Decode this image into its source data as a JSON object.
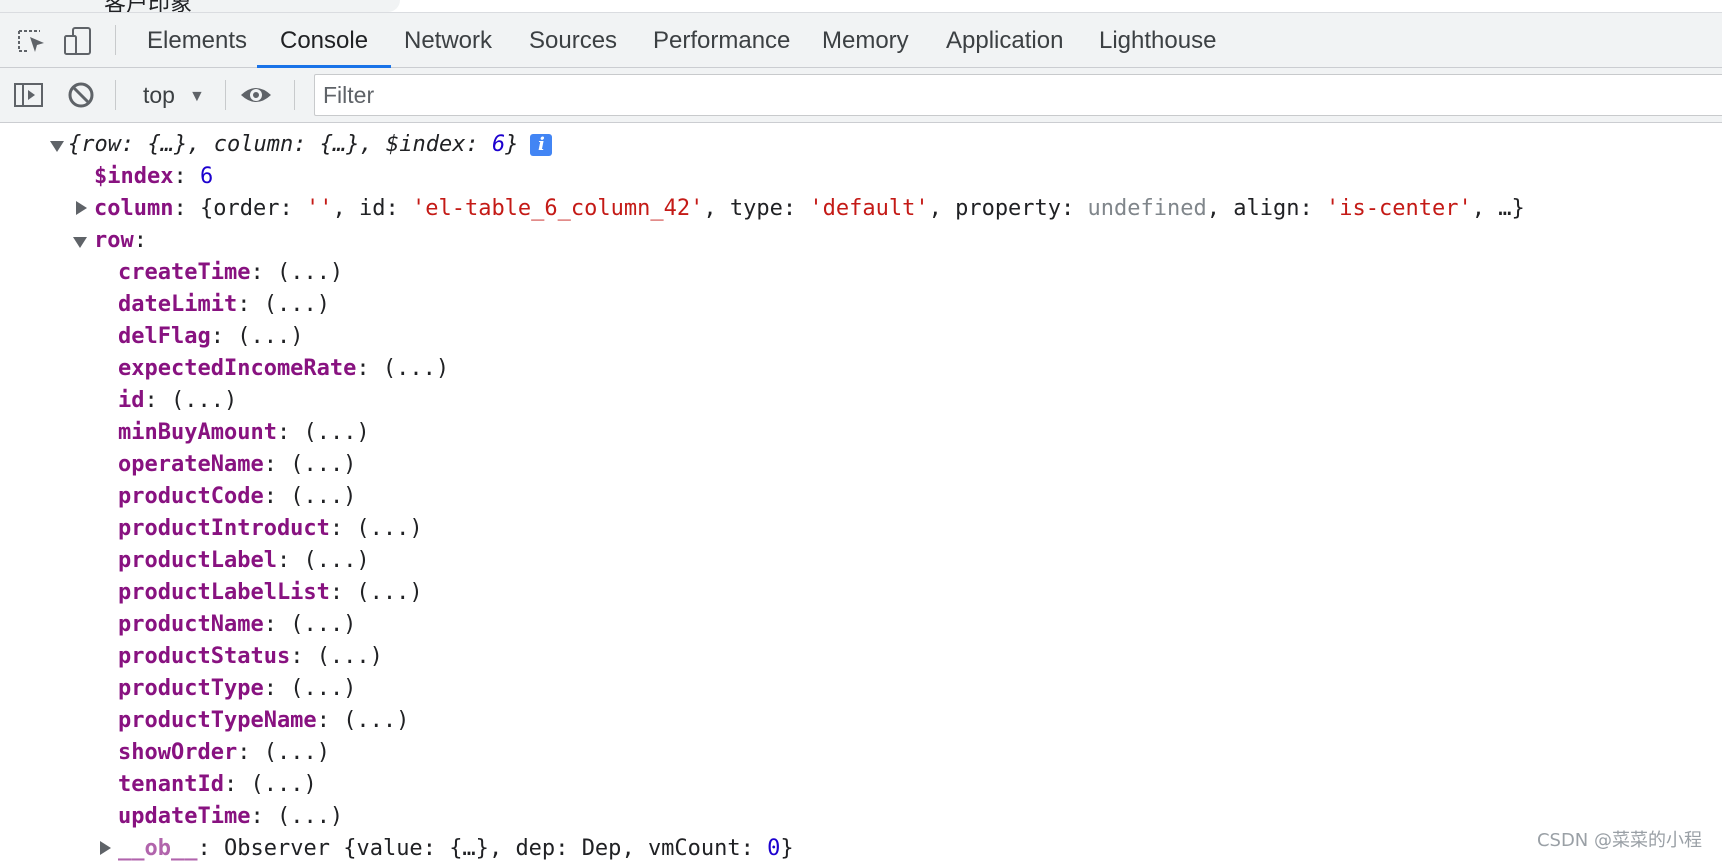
{
  "browser": {
    "partial_tab_title": "客户印象"
  },
  "devtools": {
    "tabs": [
      {
        "label": "Elements"
      },
      {
        "label": "Console"
      },
      {
        "label": "Network"
      },
      {
        "label": "Sources"
      },
      {
        "label": "Performance"
      },
      {
        "label": "Memory"
      },
      {
        "label": "Application"
      },
      {
        "label": "Lighthouse"
      }
    ],
    "active_tab": "Console",
    "toolbar": {
      "context": "top",
      "filter_placeholder": "Filter"
    }
  },
  "console": {
    "summary": {
      "open": "{",
      "row_key": "row",
      "row_val": "{…}",
      "column_key": "column",
      "column_val": "{…}",
      "index_key": "$index",
      "index_val": "6",
      "close": "}"
    },
    "index_entry": {
      "key": "$index",
      "value": "6"
    },
    "column_entry": {
      "key": "column",
      "open": "{",
      "order_key": "order",
      "order_val": "''",
      "id_key": "id",
      "id_val": "'el-table_6_column_42'",
      "type_key": "type",
      "type_val": "'default'",
      "property_key": "property",
      "property_val": "undefined",
      "align_key": "align",
      "align_val": "'is-center'",
      "tail": ", …}"
    },
    "row_key": "row",
    "getter_value": "(...)",
    "row_props": [
      {
        "key": "createTime"
      },
      {
        "key": "dateLimit"
      },
      {
        "key": "delFlag"
      },
      {
        "key": "expectedIncomeRate"
      },
      {
        "key": "id"
      },
      {
        "key": "minBuyAmount"
      },
      {
        "key": "operateName"
      },
      {
        "key": "productCode"
      },
      {
        "key": "productIntroduct"
      },
      {
        "key": "productLabel"
      },
      {
        "key": "productLabelList"
      },
      {
        "key": "productName"
      },
      {
        "key": "productStatus"
      },
      {
        "key": "productType"
      },
      {
        "key": "productTypeName"
      },
      {
        "key": "showOrder"
      },
      {
        "key": "tenantId"
      },
      {
        "key": "updateTime"
      }
    ],
    "ob_entry": {
      "key": "__ob__",
      "class_name": "Observer",
      "value_key": "value",
      "value_val": "{…}",
      "dep_key": "dep",
      "dep_val": "Dep",
      "vmcount_key": "vmCount",
      "vmcount_val": "0"
    }
  },
  "watermark": "CSDN @菜菜的小程"
}
